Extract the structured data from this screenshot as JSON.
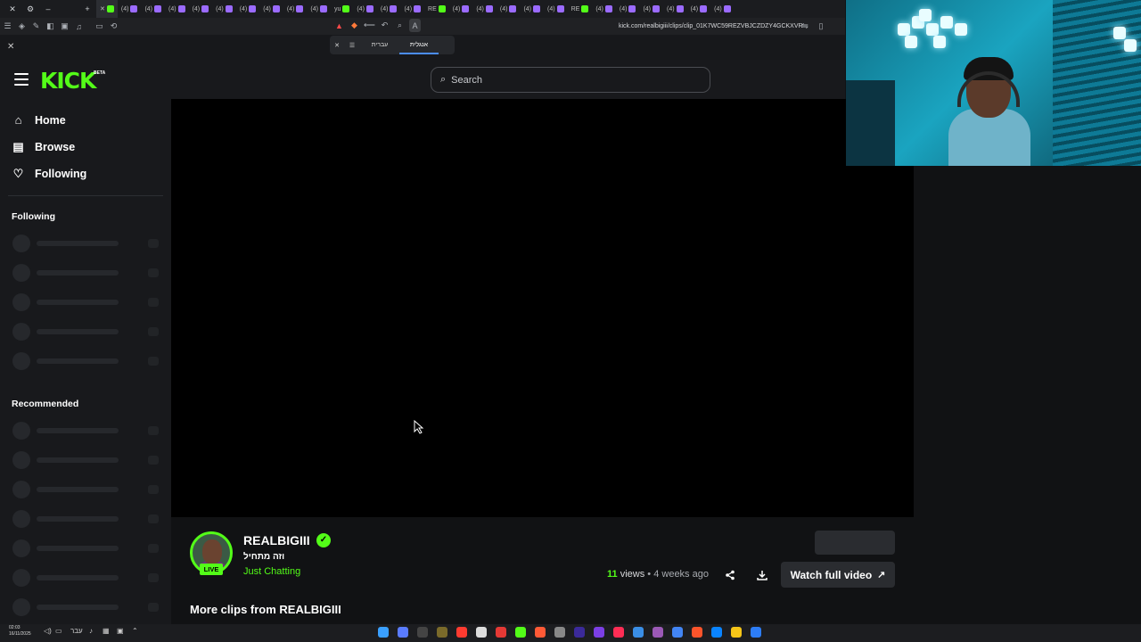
{
  "browser": {
    "tabs": [
      {
        "label": "(4)",
        "fav": "purple"
      },
      {
        "label": "(4)",
        "fav": "purple"
      },
      {
        "label": "(4)",
        "fav": "purple"
      },
      {
        "label": "(4)",
        "fav": "purple"
      },
      {
        "label": "(4)",
        "fav": "purple"
      },
      {
        "label": "(4)",
        "fav": "purple"
      },
      {
        "label": "(4)",
        "fav": "purple"
      },
      {
        "label": "(4)",
        "fav": "purple"
      },
      {
        "label": "(4)",
        "fav": "purple"
      },
      {
        "label": "yu",
        "fav": "kick"
      },
      {
        "label": "(4)",
        "fav": "purple"
      },
      {
        "label": "(4)",
        "fav": "purple"
      },
      {
        "label": "(4)",
        "fav": "purple"
      },
      {
        "label": "RE",
        "fav": "kick"
      },
      {
        "label": "(4)",
        "fav": "purple"
      },
      {
        "label": "(4)",
        "fav": "purple"
      },
      {
        "label": "(4)",
        "fav": "purple"
      },
      {
        "label": "(4)",
        "fav": "purple"
      },
      {
        "label": "(4)",
        "fav": "purple"
      },
      {
        "label": "RE",
        "fav": "kick"
      },
      {
        "label": "(4)",
        "fav": "purple"
      },
      {
        "label": "(4)",
        "fav": "purple"
      },
      {
        "label": "(4)",
        "fav": "purple"
      },
      {
        "label": "(4)",
        "fav": "purple"
      },
      {
        "label": "(4)",
        "fav": "purple"
      },
      {
        "label": "(4)",
        "fav": "purple"
      }
    ],
    "url": "kick.com/realbigiii/clips/clip_01K7WC59REZVBJCZDZY4GCKXVR",
    "translate": {
      "lang_a": "עברית",
      "lang_b": "אנגלית"
    }
  },
  "header": {
    "logo": "KICK",
    "beta": "BETA",
    "search_placeholder": "Search"
  },
  "sidebar": {
    "nav": [
      {
        "label": "Home",
        "icon": "home-icon"
      },
      {
        "label": "Browse",
        "icon": "browse-icon"
      },
      {
        "label": "Following",
        "icon": "heart-icon"
      }
    ],
    "following_title": "Following",
    "recommended_title": "Recommended"
  },
  "clip": {
    "channel_name": "REALBIGIII",
    "title": "וזה מתחיל",
    "category": "Just Chatting",
    "live_badge": "LIVE",
    "views_count": "11",
    "views_label": "views",
    "separator": "•",
    "age": "4 weeks ago",
    "watch_full": "Watch full video"
  },
  "more_clips": {
    "title": "More clips from REALBIGIII"
  },
  "taskbar": {
    "time": "02:03",
    "date": "16/11/2025",
    "lang": "עבר"
  },
  "colors": {
    "accent": "#53fc18",
    "background": "#111214",
    "panel": "#18191c"
  }
}
